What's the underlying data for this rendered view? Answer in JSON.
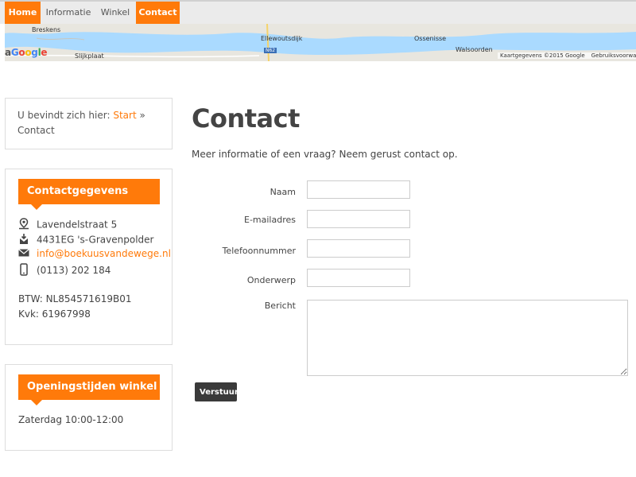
{
  "nav": {
    "items": [
      {
        "label": "Home",
        "active": true
      },
      {
        "label": "Informatie",
        "active": false
      },
      {
        "label": "Winkel",
        "active": false
      },
      {
        "label": "Contact",
        "active": true
      }
    ]
  },
  "map": {
    "places": [
      "Breskens",
      "Slijkplaat",
      "Ellewoutsdijk",
      "Ossenisse",
      "Walsoorden"
    ],
    "road": "N62",
    "logo": "Google",
    "attribution": "Kaartgegevens ©2015 Google",
    "terms": "Gebruiksvoorwa"
  },
  "breadcrumb": {
    "prefix": "U bevindt zich hier:",
    "start": "Start",
    "separator": "»",
    "current": "Contact"
  },
  "contact_widget": {
    "title": "Contactgegevens",
    "address": "Lavendelstraat 5",
    "postal": "4431EG 's-Gravenpolder",
    "email": "info@boekuusvandewege.nl",
    "phone": "(0113) 202 184",
    "btw": "BTW: NL854571619B01",
    "kvk": "Kvk: 61967998"
  },
  "hours_widget": {
    "title": "Openingstijden winkel",
    "line": "Zaterdag 10:00-12:00"
  },
  "main": {
    "title": "Contact",
    "intro": "Meer informatie of een vraag? Neem gerust contact op."
  },
  "form": {
    "name_label": "Naam",
    "email_label": "E-mailadres",
    "phone_label": "Telefoonnummer",
    "subject_label": "Onderwerp",
    "message_label": "Bericht",
    "submit_label": "Verstuur"
  },
  "colors": {
    "accent": "#ff7a0a",
    "button": "#3a3a3a"
  }
}
